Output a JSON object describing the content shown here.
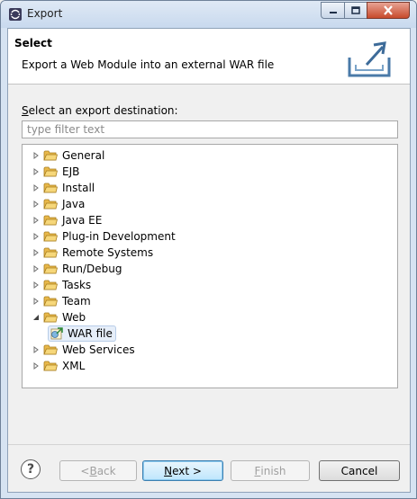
{
  "window": {
    "title": "Export"
  },
  "header": {
    "title": "Select",
    "description": "Export a Web Module into an external WAR file"
  },
  "destination": {
    "label_mnemonic": "S",
    "label_rest": "elect an export destination:",
    "filter_placeholder": "type filter text",
    "filter_value": ""
  },
  "tree": {
    "items": [
      {
        "label": "General",
        "expanded": false
      },
      {
        "label": "EJB",
        "expanded": false
      },
      {
        "label": "Install",
        "expanded": false
      },
      {
        "label": "Java",
        "expanded": false
      },
      {
        "label": "Java EE",
        "expanded": false
      },
      {
        "label": "Plug-in Development",
        "expanded": false
      },
      {
        "label": "Remote Systems",
        "expanded": false
      },
      {
        "label": "Run/Debug",
        "expanded": false
      },
      {
        "label": "Tasks",
        "expanded": false
      },
      {
        "label": "Team",
        "expanded": false
      },
      {
        "label": "Web",
        "expanded": true,
        "children": [
          {
            "label": "WAR file",
            "selected": true
          }
        ]
      },
      {
        "label": "Web Services",
        "expanded": false
      },
      {
        "label": "XML",
        "expanded": false
      }
    ]
  },
  "buttons": {
    "help": "?",
    "back_prefix": "< ",
    "back_mnemonic": "B",
    "back_rest": "ack",
    "next_mnemonic": "N",
    "next_rest": "ext >",
    "finish_mnemonic": "F",
    "finish_rest": "inish",
    "cancel": "Cancel"
  },
  "colors": {
    "folder": "#e8b84a",
    "selection": "#e6eef9",
    "default_button_border": "#3c7fb1"
  }
}
